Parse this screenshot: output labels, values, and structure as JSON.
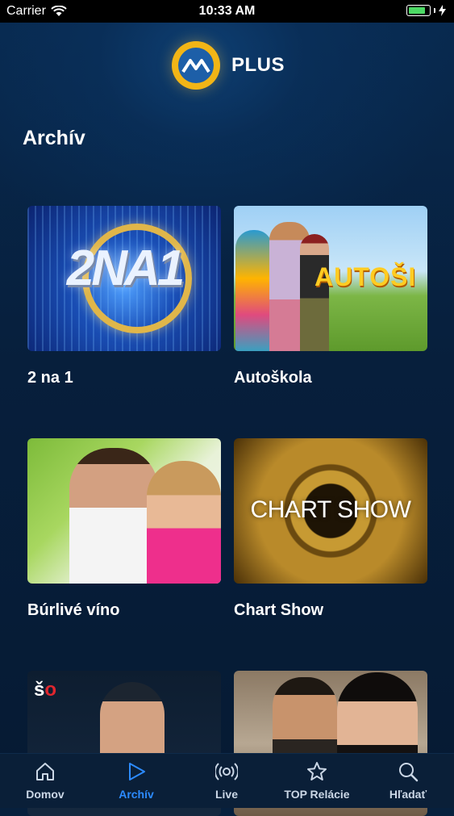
{
  "status_bar": {
    "carrier": "Carrier",
    "time": "10:33 AM",
    "battery_level": 0.85
  },
  "header": {
    "logo_text": "PLUS",
    "logo_icon": "markiza-logo-icon"
  },
  "page": {
    "title": "Archív"
  },
  "shows": [
    {
      "title": "2 na 1",
      "thumb_text": "2NA1"
    },
    {
      "title": "Autoškola",
      "thumb_text": "AUTOŠI"
    },
    {
      "title": "Búrlivé víno"
    },
    {
      "title": "Chart Show",
      "thumb_text": "CHART SHOW"
    },
    {
      "title": "",
      "thumb_text_a": "š",
      "thumb_text_b": "o"
    },
    {
      "title": ""
    }
  ],
  "tab_bar": {
    "items": [
      {
        "label": "Domov",
        "icon": "home-icon",
        "active": false
      },
      {
        "label": "Archív",
        "icon": "play-icon",
        "active": true
      },
      {
        "label": "Live",
        "icon": "broadcast-icon",
        "active": false
      },
      {
        "label": "TOP Relácie",
        "icon": "star-icon",
        "active": false
      },
      {
        "label": "Hľadať",
        "icon": "search-icon",
        "active": false
      }
    ]
  },
  "colors": {
    "accent": "#2c8bff",
    "background": "#07203d",
    "logo_yellow": "#f2b516",
    "battery_green": "#4cd964"
  }
}
